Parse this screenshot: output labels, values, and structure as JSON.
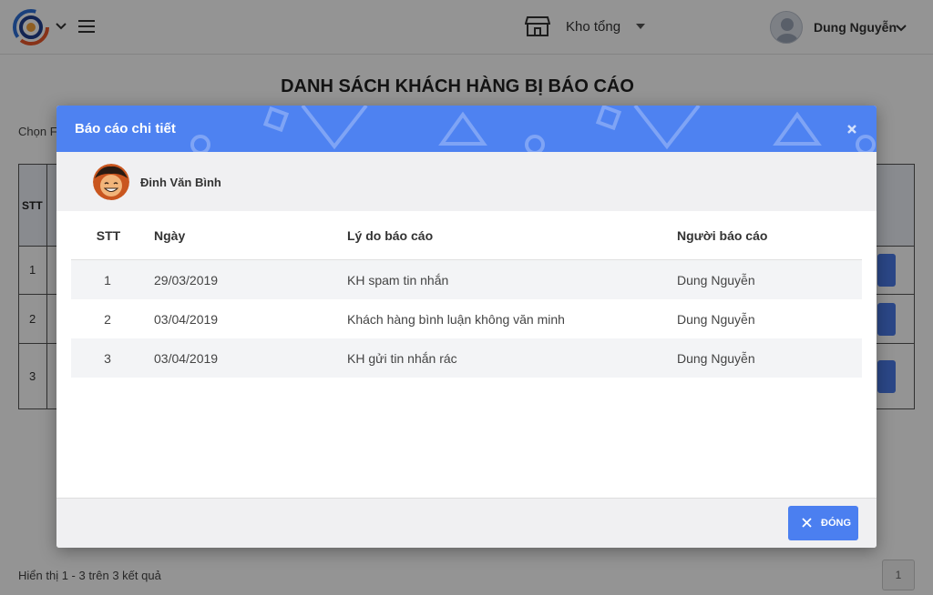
{
  "header": {
    "store_label": "Kho tổng",
    "user_name": "Dung Nguyễn"
  },
  "page": {
    "title": "DANH SÁCH KHÁCH HÀNG BỊ BÁO CÁO",
    "filter_label": "Chọn F",
    "table_header_stt": "STT",
    "row_numbers": [
      "1",
      "2",
      "3"
    ],
    "pagination_info": "Hiển thị 1 - 3 trên 3 kết quả",
    "current_page": "1"
  },
  "modal": {
    "title": "Báo cáo chi tiết",
    "customer_name": "Đinh Văn Bình",
    "columns": {
      "stt": "STT",
      "date": "Ngày",
      "reason": "Lý do báo cáo",
      "reporter": "Người báo cáo"
    },
    "rows": [
      {
        "stt": "1",
        "date": "29/03/2019",
        "reason": "KH spam tin nhắn",
        "reporter": "Dung Nguyễn"
      },
      {
        "stt": "2",
        "date": "03/04/2019",
        "reason": "Khách hàng bình luận không văn minh",
        "reporter": "Dung Nguyễn"
      },
      {
        "stt": "3",
        "date": "03/04/2019",
        "reason": "KH gửi tin nhắn rác",
        "reporter": "Dung Nguyễn"
      }
    ],
    "close_button_label": "ĐÓNG"
  },
  "colors": {
    "accent": "#4e82f1",
    "button": "#4b7ff0",
    "overlay": "rgba(0,0,0,0.42)"
  },
  "icons": {
    "logo": "app-logo-icon",
    "menu": "hamburger-icon",
    "store": "store-icon",
    "close": "close-icon"
  }
}
